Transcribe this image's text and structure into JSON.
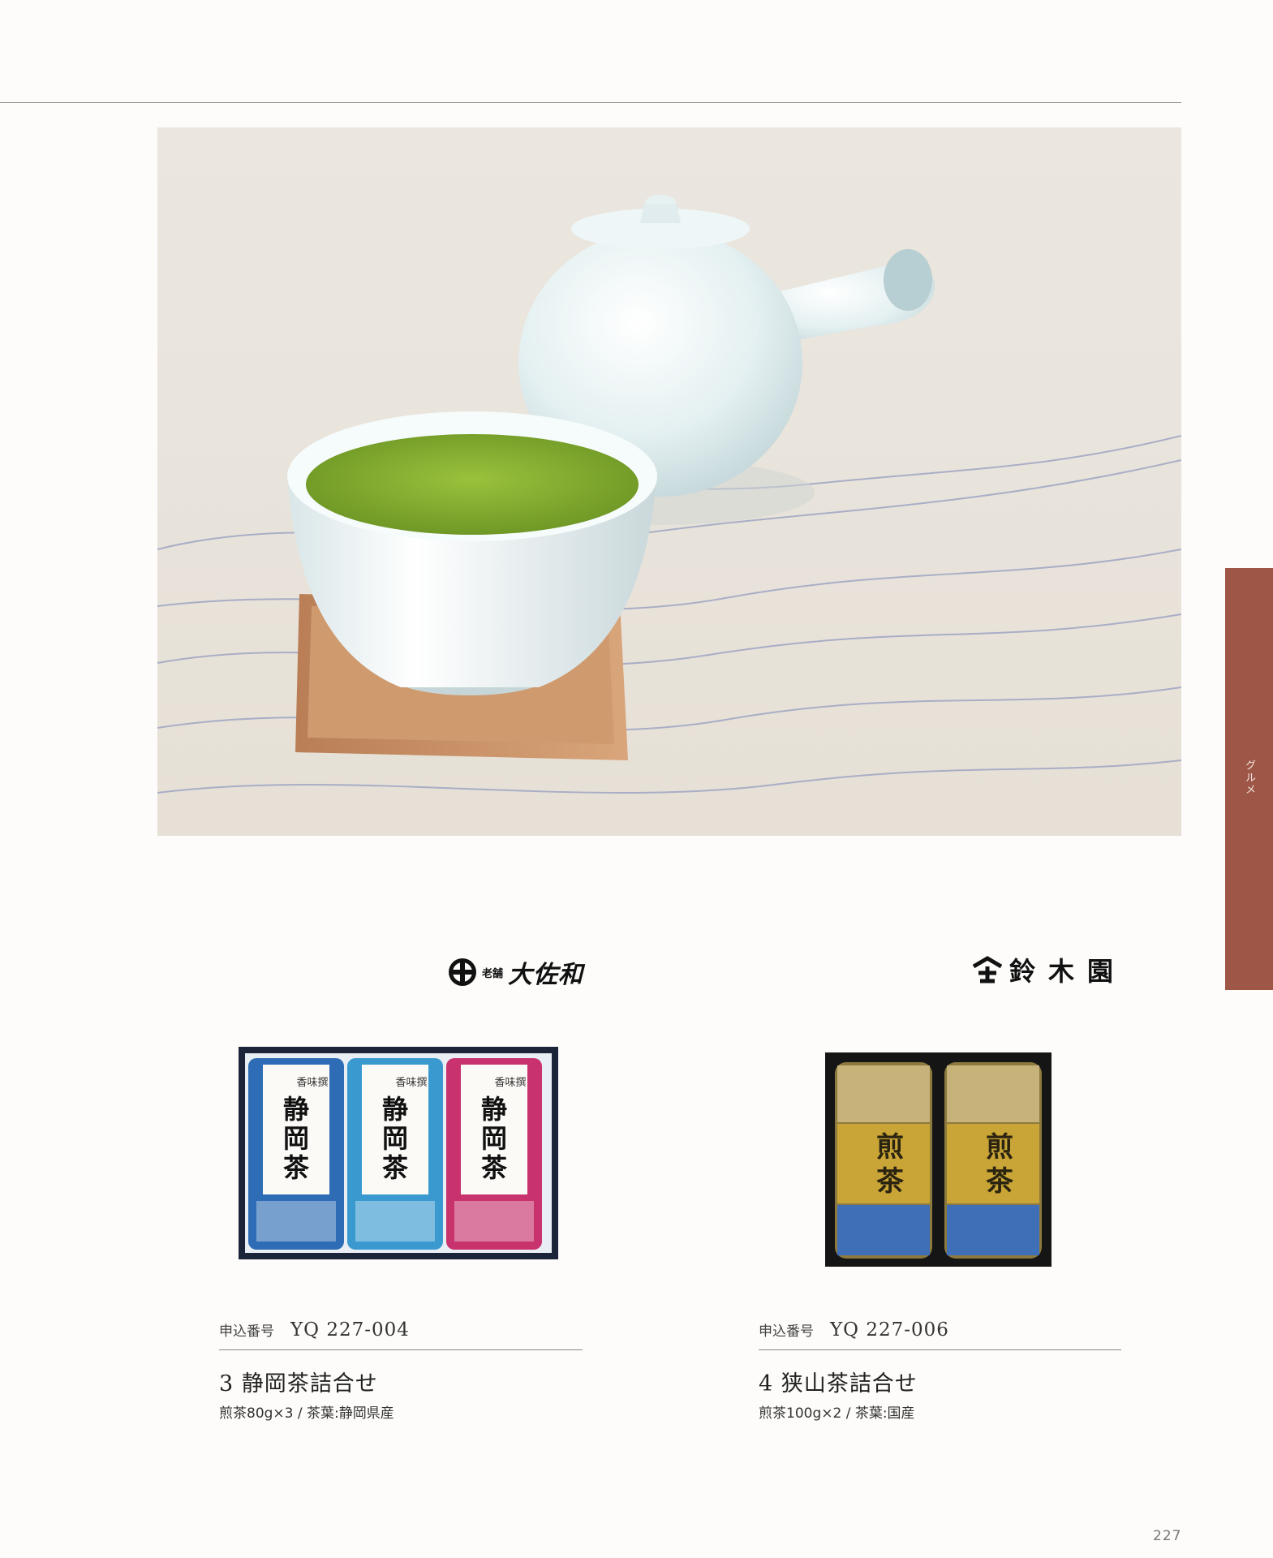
{
  "side_tab": {
    "label": "グルメ"
  },
  "hero": {
    "icon": "teapot-and-teacup-photo"
  },
  "brands": {
    "left": {
      "small": "老舗",
      "name": "大佐和"
    },
    "right": {
      "name": "鈴木園"
    }
  },
  "products": [
    {
      "order_label": "申込番号",
      "order_code": "YQ 227-004",
      "title": "3 静岡茶詰合せ",
      "description": "煎茶80g×3 / 茶葉:静岡県産",
      "can_labels": [
        "静岡茶",
        "静岡茶",
        "静岡茶"
      ],
      "can_sub": [
        "香味撰",
        "香味撰",
        "香味撰"
      ],
      "colors": [
        "#2e6db5",
        "#3a9ad0",
        "#c8336e"
      ]
    },
    {
      "order_label": "申込番号",
      "order_code": "YQ 227-006",
      "title": "4 狭山茶詰合せ",
      "description": "煎茶100g×2 / 茶葉:国産",
      "can_labels": [
        "煎茶",
        "煎茶"
      ],
      "colors": [
        "#c9a436",
        "#c9a436"
      ]
    }
  ],
  "page_number": "227"
}
